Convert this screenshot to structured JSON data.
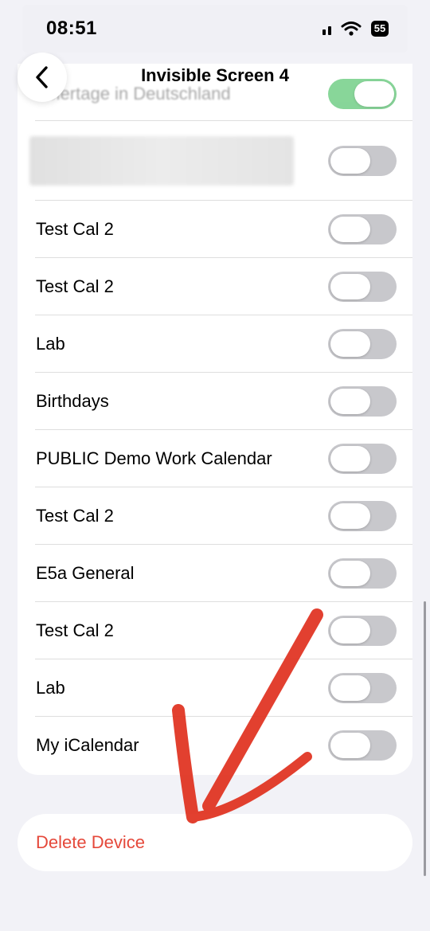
{
  "status_bar": {
    "time": "08:51",
    "battery_text": "55"
  },
  "header": {
    "title": "Invisible Screen 4"
  },
  "calendars": [
    {
      "label": "Feiertage in Deutschland",
      "enabled": true
    },
    {
      "label": "",
      "enabled": false,
      "blurred": true
    },
    {
      "label": "Test Cal 2",
      "enabled": false
    },
    {
      "label": "Test Cal 2",
      "enabled": false
    },
    {
      "label": "Lab",
      "enabled": false
    },
    {
      "label": "Birthdays",
      "enabled": false
    },
    {
      "label": "PUBLIC Demo Work Calendar",
      "enabled": false
    },
    {
      "label": "Test Cal 2",
      "enabled": false
    },
    {
      "label": "E5a General",
      "enabled": false
    },
    {
      "label": "Test Cal 2",
      "enabled": false
    },
    {
      "label": "Lab",
      "enabled": false
    },
    {
      "label": "My iCalendar",
      "enabled": false
    }
  ],
  "delete_action": {
    "label": "Delete Device",
    "color": "#e5483a"
  },
  "colors": {
    "toggle_on": "#60c877",
    "toggle_off": "#c8c8cc",
    "annotation": "#e0301e"
  },
  "icons": {
    "back": "chevron-left-icon",
    "signal": "cellular-signal-icon",
    "wifi": "wifi-icon",
    "battery": "battery-icon"
  }
}
